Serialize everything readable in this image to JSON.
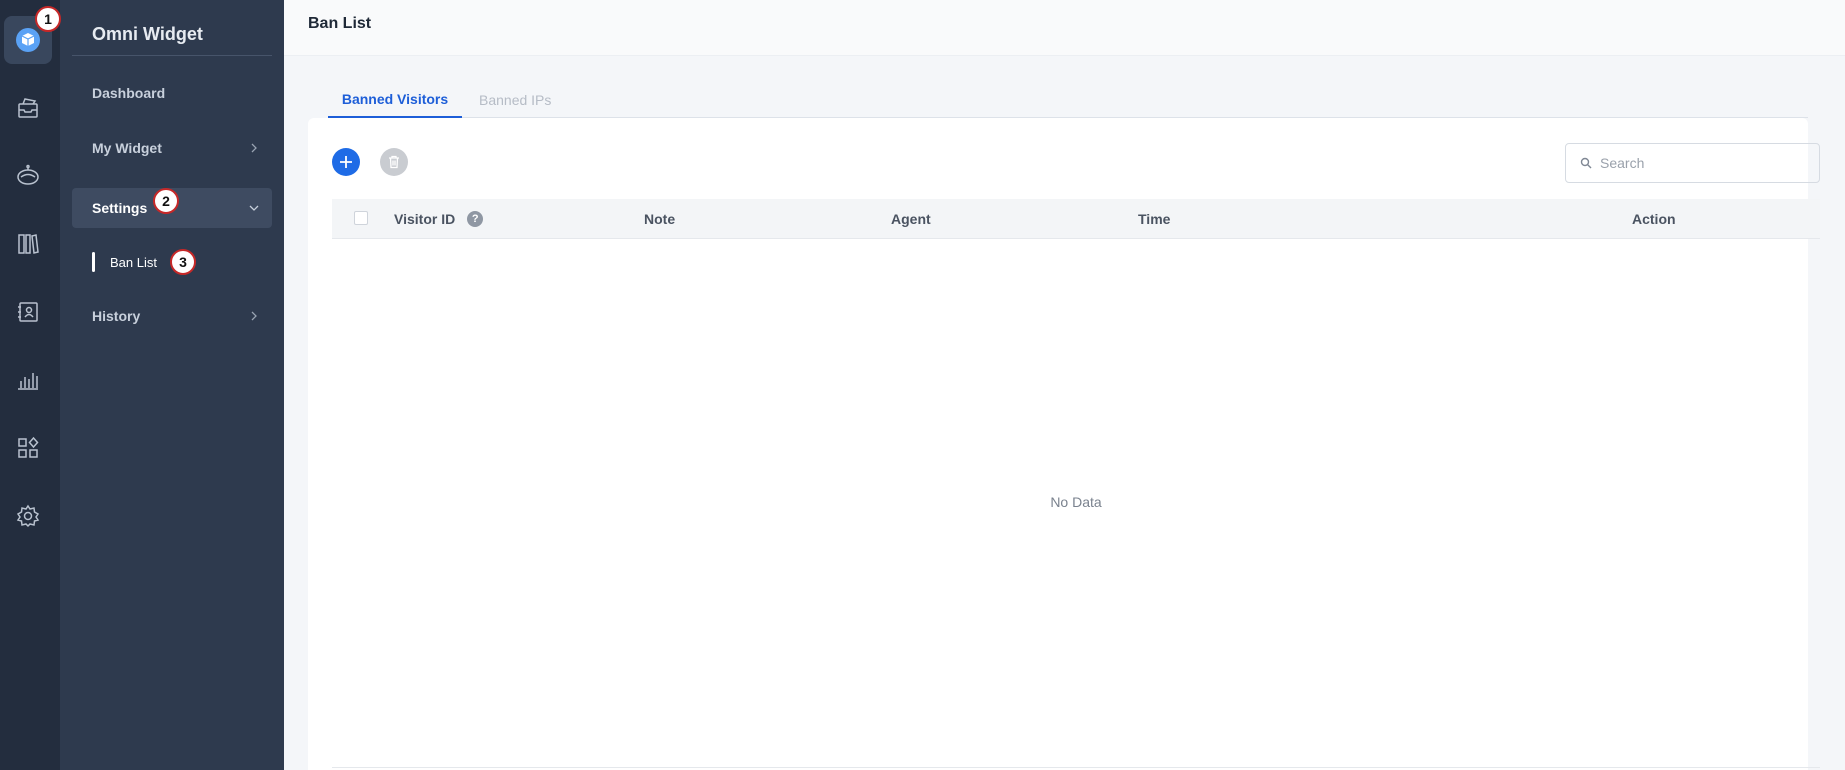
{
  "app": {
    "title": "Omni Widget"
  },
  "page": {
    "title": "Ban List"
  },
  "rail": {
    "items": [
      {
        "icon": "widget-cube-icon",
        "active": true
      },
      {
        "icon": "inbox-icon"
      },
      {
        "icon": "bot-icon"
      },
      {
        "icon": "knowledge-base-icon"
      },
      {
        "icon": "contacts-icon"
      },
      {
        "icon": "analytics-icon"
      },
      {
        "icon": "apps-icon"
      },
      {
        "icon": "gear-icon"
      }
    ]
  },
  "nav": {
    "dashboard": "Dashboard",
    "my_widget": "My Widget",
    "settings": "Settings",
    "ban_list": "Ban List",
    "history": "History"
  },
  "badges": [
    "1",
    "2",
    "3"
  ],
  "tabs": {
    "active": "Banned Visitors",
    "inactive": "Banned IPs"
  },
  "search": {
    "placeholder": "Search",
    "value": ""
  },
  "table": {
    "columns": [
      "Visitor ID",
      "Note",
      "Agent",
      "Time",
      "Action"
    ],
    "help_glyph": "?",
    "empty_text": "No Data",
    "rows": []
  },
  "colors": {
    "accent": "#1d5ed8",
    "sidebar": "#2e3a4e",
    "rail": "#232d3e",
    "badge_border": "#c62828"
  }
}
